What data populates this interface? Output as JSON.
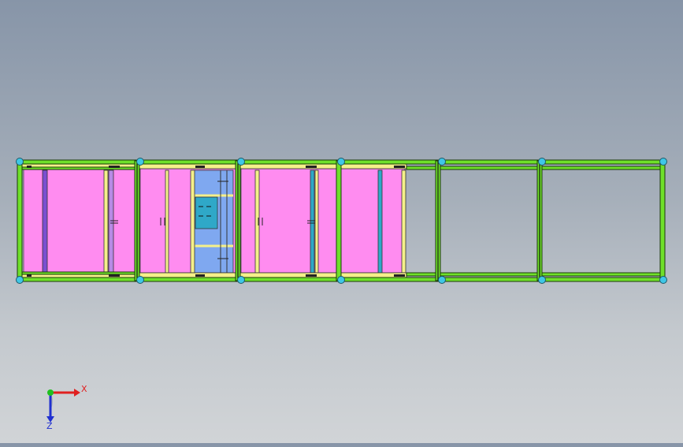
{
  "viewport": {
    "background_top": "#8795a8",
    "background_bottom": "#d1d4d7"
  },
  "model": {
    "frame_color": "#6fe02a",
    "frame_outline": "#1a3a08",
    "panel_color": "#ff8cf0",
    "rail_color": "#f5f08a",
    "node_color": "#3fc7e6",
    "blue_fill": "#7fa8f0",
    "teal_fill": "#2fa8c8",
    "purple_bar": "#7a4fd0"
  },
  "triad": {
    "x_label": "X",
    "z_label": "Z",
    "x_color": "#e02020",
    "y_color": "#20c020",
    "z_color": "#2030d0"
  }
}
